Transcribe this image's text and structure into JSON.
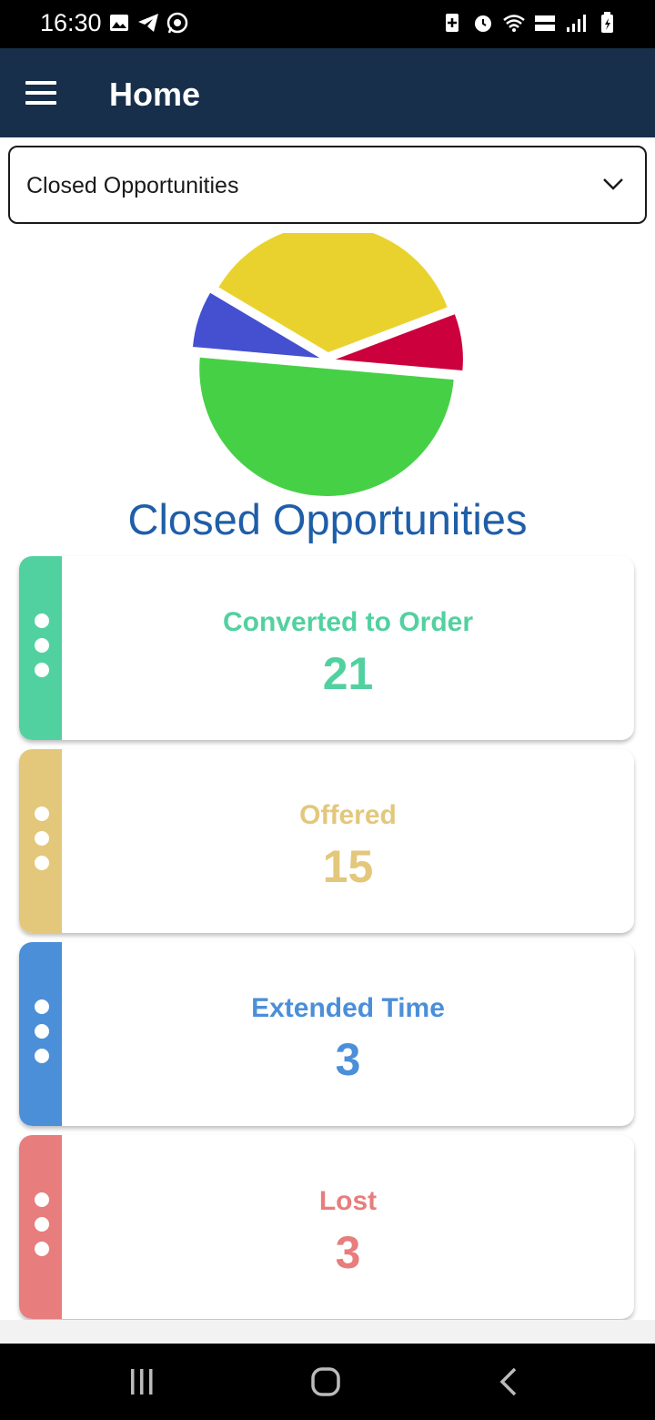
{
  "status_bar": {
    "time": "16:30"
  },
  "app_bar": {
    "title": "Home",
    "menu_icon": "hamburger-menu-icon"
  },
  "filter": {
    "selected": "Closed Opportunities",
    "icon": "chevron-down-icon"
  },
  "chart_data": {
    "type": "pie",
    "title": "Closed Opportunities",
    "slices": [
      {
        "label": "Converted to Order",
        "value": 21,
        "color": "#46d046"
      },
      {
        "label": "Extended Time",
        "value": 3,
        "color": "#4450d0"
      },
      {
        "label": "Offered",
        "value": 15,
        "color": "#ead22e"
      },
      {
        "label": "Lost",
        "value": 3,
        "color": "#cc003c"
      }
    ]
  },
  "cards": [
    {
      "label": "Converted to Order",
      "value": "21",
      "color": "#52d1a0"
    },
    {
      "label": "Offered",
      "value": "15",
      "color": "#e3c77b"
    },
    {
      "label": "Extended Time",
      "value": "3",
      "color": "#4b8fd8"
    },
    {
      "label": "Lost",
      "value": "3",
      "color": "#e87d7d"
    }
  ],
  "colors": {
    "app_bar": "#172f4a",
    "chart_title": "#1f5ea8"
  }
}
